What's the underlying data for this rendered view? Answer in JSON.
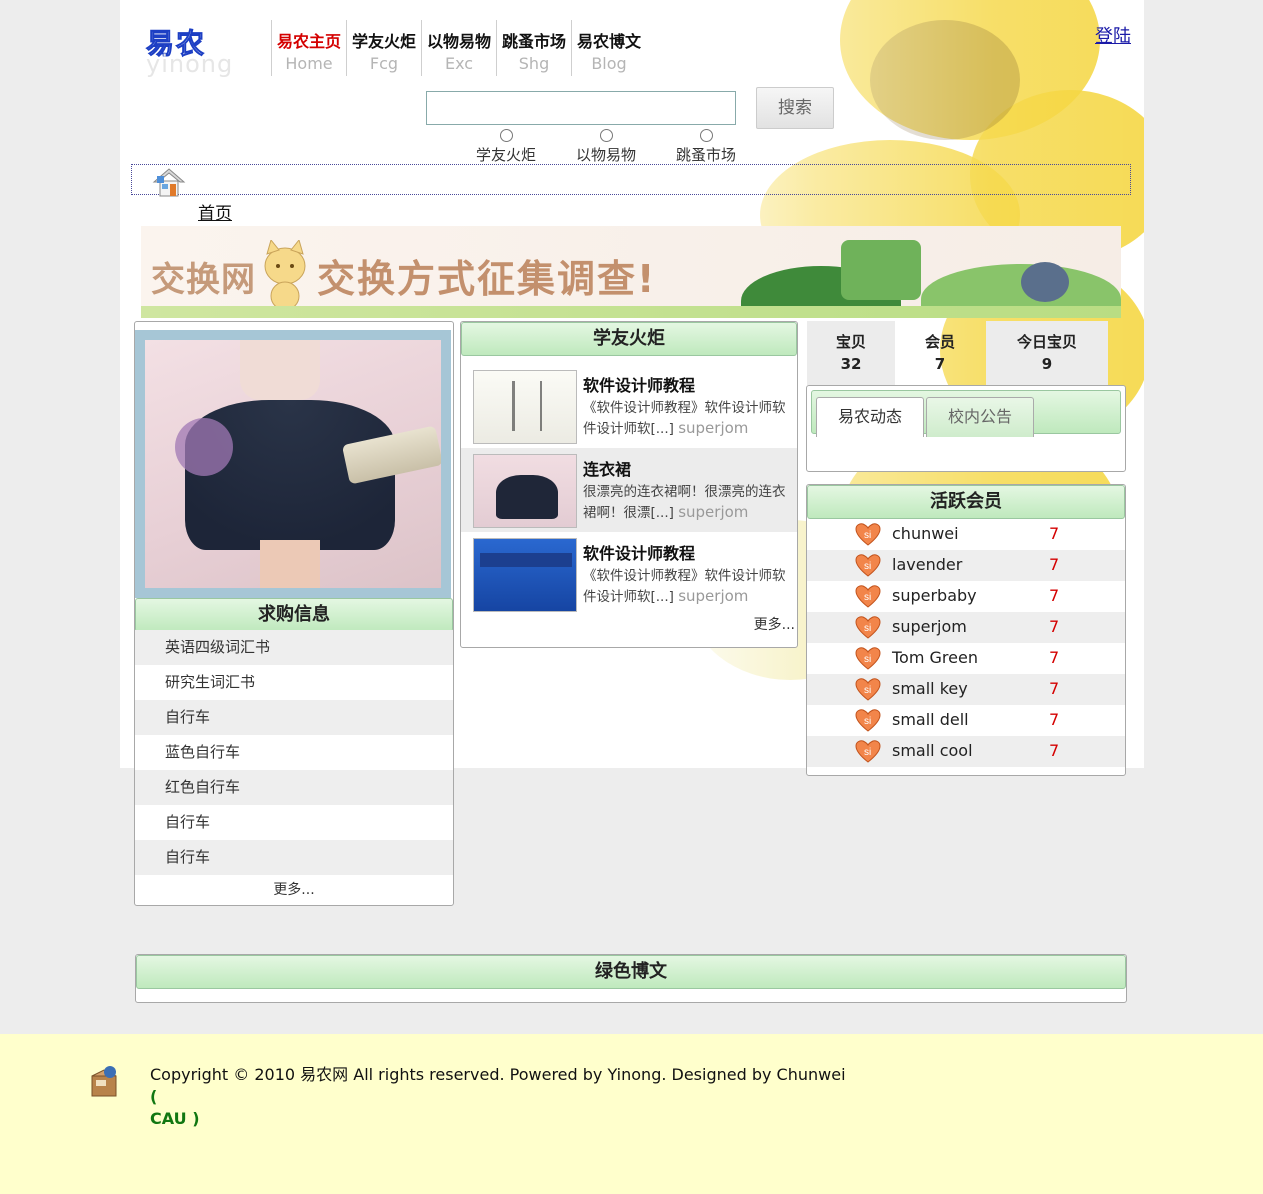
{
  "header": {
    "logo_cn": "易农",
    "logo_en": "yinong",
    "login": "登陆"
  },
  "nav": [
    {
      "cn": "易农主页",
      "en": "Home"
    },
    {
      "cn": "学友火炬",
      "en": "Fcg"
    },
    {
      "cn": "以物易物",
      "en": "Exc"
    },
    {
      "cn": "跳蚤市场",
      "en": "Shg"
    },
    {
      "cn": "易农博文",
      "en": "Blog"
    }
  ],
  "search": {
    "button": "搜索",
    "options": [
      "学友火炬",
      "以物易物",
      "跳蚤市场"
    ]
  },
  "breadcrumb": "首页",
  "banner": {
    "site": "交换网",
    "headline": "交换方式征集调查!"
  },
  "want": {
    "title": "求购信息",
    "items": [
      "英语四级词汇书",
      "研究生词汇书",
      "自行车",
      "蓝色自行车",
      "红色自行车",
      "自行车",
      "自行车"
    ],
    "more": "更多..."
  },
  "torch": {
    "title": "学友火炬",
    "items": [
      {
        "title": "软件设计师教程",
        "desc": "《软件设计师教程》软件设计师软件设计师软[...]",
        "user": "superjom"
      },
      {
        "title": "连衣裙",
        "desc": "很漂亮的连衣裙啊！很漂亮的连衣裙啊！很漂[...]",
        "user": "superjom"
      },
      {
        "title": "软件设计师教程",
        "desc": "《软件设计师教程》软件设计师软件设计师软[...]",
        "user": "superjom"
      }
    ],
    "more": "更多..."
  },
  "stats": [
    {
      "label": "宝贝",
      "value": "32"
    },
    {
      "label": "会员",
      "value": "7"
    },
    {
      "label": "今日宝贝",
      "value": "9"
    }
  ],
  "tabs": [
    "易农动态",
    "校内公告"
  ],
  "members": {
    "title": "活跃会员",
    "items": [
      {
        "name": "chunwei",
        "count": "7"
      },
      {
        "name": "lavender",
        "count": "7"
      },
      {
        "name": "superbaby",
        "count": "7"
      },
      {
        "name": "superjom",
        "count": "7"
      },
      {
        "name": "Tom Green",
        "count": "7"
      },
      {
        "name": "small key",
        "count": "7"
      },
      {
        "name": "small dell",
        "count": "7"
      },
      {
        "name": "small cool",
        "count": "7"
      }
    ]
  },
  "blog": {
    "title": "绿色博文"
  },
  "footer": {
    "text": "Copyright © 2010 易农网 All rights reserved. Powered by Yinong.    Designed by Chunwei",
    "open": "(",
    "cau": "CAU )"
  },
  "colors": {
    "accent": "#d40000",
    "panel_green": "#bfe9bd",
    "footer_bg": "#ffffcc"
  }
}
